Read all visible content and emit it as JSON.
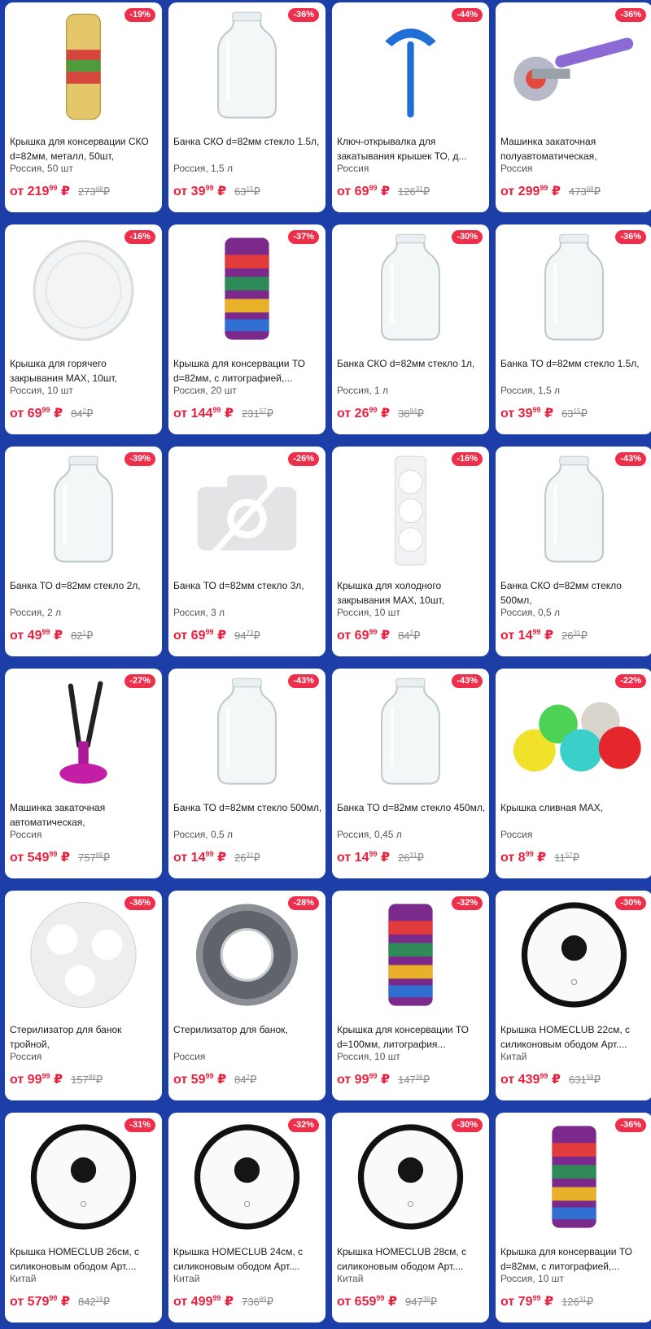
{
  "products": [
    {
      "discount": "-19%",
      "title": "Крышка для консервации СКО d=82мм, металл, 50шт,",
      "origin": "Россия, 50 шт",
      "price_prefix": "от",
      "price_main": "219",
      "price_cents": "99",
      "currency": "₽",
      "old_main": "273",
      "old_cents": "68",
      "old_currency": "₽",
      "icon": "lid-stack-icon"
    },
    {
      "discount": "-36%",
      "title": "Банка СКО d=82мм стекло 1.5л,",
      "origin": "Россия, 1,5 л",
      "price_prefix": "от",
      "price_main": "39",
      "price_cents": "99",
      "currency": "₽",
      "old_main": "63",
      "old_cents": "15",
      "old_currency": "₽",
      "icon": "glass-jar-icon"
    },
    {
      "discount": "-44%",
      "title": "Ключ-открывалка для закатывания крышек ТО, д...",
      "origin": "Россия",
      "price_prefix": "от",
      "price_main": "69",
      "price_cents": "99",
      "currency": "₽",
      "old_main": "126",
      "old_cents": "31",
      "old_currency": "₽",
      "icon": "wrench-opener-icon"
    },
    {
      "discount": "-36%",
      "title": "Машинка закаточная полуавтоматическая,",
      "origin": "Россия",
      "price_prefix": "от",
      "price_main": "299",
      "price_cents": "99",
      "currency": "₽",
      "old_main": "473",
      "old_cents": "68",
      "old_currency": "₽",
      "icon": "seamer-tool-icon"
    },
    {
      "discount": "-16%",
      "title": "Крышка для горячего закрывания МАХ, 10шт,",
      "origin": "Россия, 10 шт",
      "price_prefix": "от",
      "price_main": "69",
      "price_cents": "99",
      "currency": "₽",
      "old_main": "84",
      "old_cents": "2",
      "old_currency": "₽",
      "icon": "plastic-lid-icon"
    },
    {
      "discount": "-37%",
      "title": "Крышка для консервации ТО d=82мм, с литографией,...",
      "origin": "Россия, 20 шт",
      "price_prefix": "от",
      "price_main": "144",
      "price_cents": "99",
      "currency": "₽",
      "old_main": "231",
      "old_cents": "57",
      "old_currency": "₽",
      "icon": "lid-stack-colored-icon"
    },
    {
      "discount": "-30%",
      "title": "Банка СКО d=82мм стекло 1л,",
      "origin": "Россия, 1 л",
      "price_prefix": "от",
      "price_main": "26",
      "price_cents": "99",
      "currency": "₽",
      "old_main": "38",
      "old_cents": "94",
      "old_currency": "₽",
      "icon": "glass-jar-icon"
    },
    {
      "discount": "-36%",
      "title": "Банка ТО d=82мм стекло 1.5л,",
      "origin": "Россия, 1,5 л",
      "price_prefix": "от",
      "price_main": "39",
      "price_cents": "99",
      "currency": "₽",
      "old_main": "63",
      "old_cents": "15",
      "old_currency": "₽",
      "icon": "glass-jar-icon"
    },
    {
      "discount": "-39%",
      "title": "Банка ТО d=82мм стекло 2л,",
      "origin": "Россия, 2 л",
      "price_prefix": "от",
      "price_main": "49",
      "price_cents": "99",
      "currency": "₽",
      "old_main": "82",
      "old_cents": "1",
      "old_currency": "₽",
      "icon": "glass-jar-icon"
    },
    {
      "discount": "-26%",
      "title": "Банка ТО d=82мм стекло 3л,",
      "origin": "Россия, 3 л",
      "price_prefix": "от",
      "price_main": "69",
      "price_cents": "99",
      "currency": "₽",
      "old_main": "94",
      "old_cents": "73",
      "old_currency": "₽",
      "icon": "no-photo-icon"
    },
    {
      "discount": "-16%",
      "title": "Крышка для холодного закрывания МАХ, 10шт,",
      "origin": "Россия, 10 шт",
      "price_prefix": "от",
      "price_main": "69",
      "price_cents": "99",
      "currency": "₽",
      "old_main": "84",
      "old_cents": "2",
      "old_currency": "₽",
      "icon": "lid-pack-icon"
    },
    {
      "discount": "-43%",
      "title": "Банка СКО d=82мм стекло 500мл,",
      "origin": "Россия, 0,5 л",
      "price_prefix": "от",
      "price_main": "14",
      "price_cents": "99",
      "currency": "₽",
      "old_main": "26",
      "old_cents": "31",
      "old_currency": "₽",
      "icon": "glass-jar-icon"
    },
    {
      "discount": "-27%",
      "title": "Машинка закаточная автоматическая,",
      "origin": "Россия",
      "price_prefix": "от",
      "price_main": "549",
      "price_cents": "99",
      "currency": "₽",
      "old_main": "757",
      "old_cents": "89",
      "old_currency": "₽",
      "icon": "auto-seamer-icon"
    },
    {
      "discount": "-43%",
      "title": "Банка ТО d=82мм стекло 500мл,",
      "origin": "Россия, 0,5 л",
      "price_prefix": "от",
      "price_main": "14",
      "price_cents": "99",
      "currency": "₽",
      "old_main": "26",
      "old_cents": "31",
      "old_currency": "₽",
      "icon": "glass-jar-icon"
    },
    {
      "discount": "-43%",
      "title": "Банка ТО d=82мм стекло 450мл,",
      "origin": "Россия, 0,45 л",
      "price_prefix": "от",
      "price_main": "14",
      "price_cents": "99",
      "currency": "₽",
      "old_main": "26",
      "old_cents": "31",
      "old_currency": "₽",
      "icon": "glass-jar-icon"
    },
    {
      "discount": "-22%",
      "title": "Крышка сливная МАХ,",
      "origin": "Россия",
      "price_prefix": "от",
      "price_main": "8",
      "price_cents": "99",
      "currency": "₽",
      "old_main": "11",
      "old_cents": "57",
      "old_currency": "₽",
      "icon": "drain-lids-icon"
    },
    {
      "discount": "-36%",
      "title": "Стерилизатор для банок тройной,",
      "origin": "Россия",
      "price_prefix": "от",
      "price_main": "99",
      "price_cents": "99",
      "currency": "₽",
      "old_main": "157",
      "old_cents": "89",
      "old_currency": "₽",
      "icon": "triple-sterilizer-icon"
    },
    {
      "discount": "-28%",
      "title": "Стерилизатор для банок,",
      "origin": "Россия",
      "price_prefix": "от",
      "price_main": "59",
      "price_cents": "99",
      "currency": "₽",
      "old_main": "84",
      "old_cents": "2",
      "old_currency": "₽",
      "icon": "metal-sterilizer-icon"
    },
    {
      "discount": "-32%",
      "title": "Крышка для консервации ТО d=100мм, литография...",
      "origin": "Россия, 10 шт",
      "price_prefix": "от",
      "price_main": "99",
      "price_cents": "99",
      "currency": "₽",
      "old_main": "147",
      "old_cents": "36",
      "old_currency": "₽",
      "icon": "lid-stack-colored-icon"
    },
    {
      "discount": "-30%",
      "title": "Крышка HOMECLUB 22см, с силиконовым ободом Арт....",
      "origin": "Китай",
      "price_prefix": "от",
      "price_main": "439",
      "price_cents": "99",
      "currency": "₽",
      "old_main": "631",
      "old_cents": "59",
      "old_currency": "₽",
      "icon": "glass-lid-icon"
    },
    {
      "discount": "-31%",
      "title": "Крышка HOMECLUB 26см, с силиконовым ободом Арт....",
      "origin": "Китай",
      "price_prefix": "от",
      "price_main": "579",
      "price_cents": "99",
      "currency": "₽",
      "old_main": "842",
      "old_cents": "19",
      "old_currency": "₽",
      "icon": "glass-lid-icon"
    },
    {
      "discount": "-32%",
      "title": "Крышка HOMECLUB 24см, с силиконовым ободом Арт....",
      "origin": "Китай",
      "price_prefix": "от",
      "price_main": "499",
      "price_cents": "99",
      "currency": "₽",
      "old_main": "736",
      "old_cents": "89",
      "old_currency": "₽",
      "icon": "glass-lid-icon"
    },
    {
      "discount": "-30%",
      "title": "Крышка HOMECLUB 28см, с силиконовым ободом Арт....",
      "origin": "Китай",
      "price_prefix": "от",
      "price_main": "659",
      "price_cents": "99",
      "currency": "₽",
      "old_main": "947",
      "old_cents": "39",
      "old_currency": "₽",
      "icon": "glass-lid-icon"
    },
    {
      "discount": "-36%",
      "title": "Крышка для консервации ТО d=82мм, с литографией,...",
      "origin": "Россия, 10 шт",
      "price_prefix": "от",
      "price_main": "79",
      "price_cents": "99",
      "currency": "₽",
      "old_main": "126",
      "old_cents": "31",
      "old_currency": "₽",
      "icon": "lid-stack-colored-icon"
    }
  ],
  "colors": {
    "background": "#1c3ea6",
    "badge": "#ee2f4b",
    "price": "#e8213e",
    "old_price": "#8a8a8a"
  }
}
